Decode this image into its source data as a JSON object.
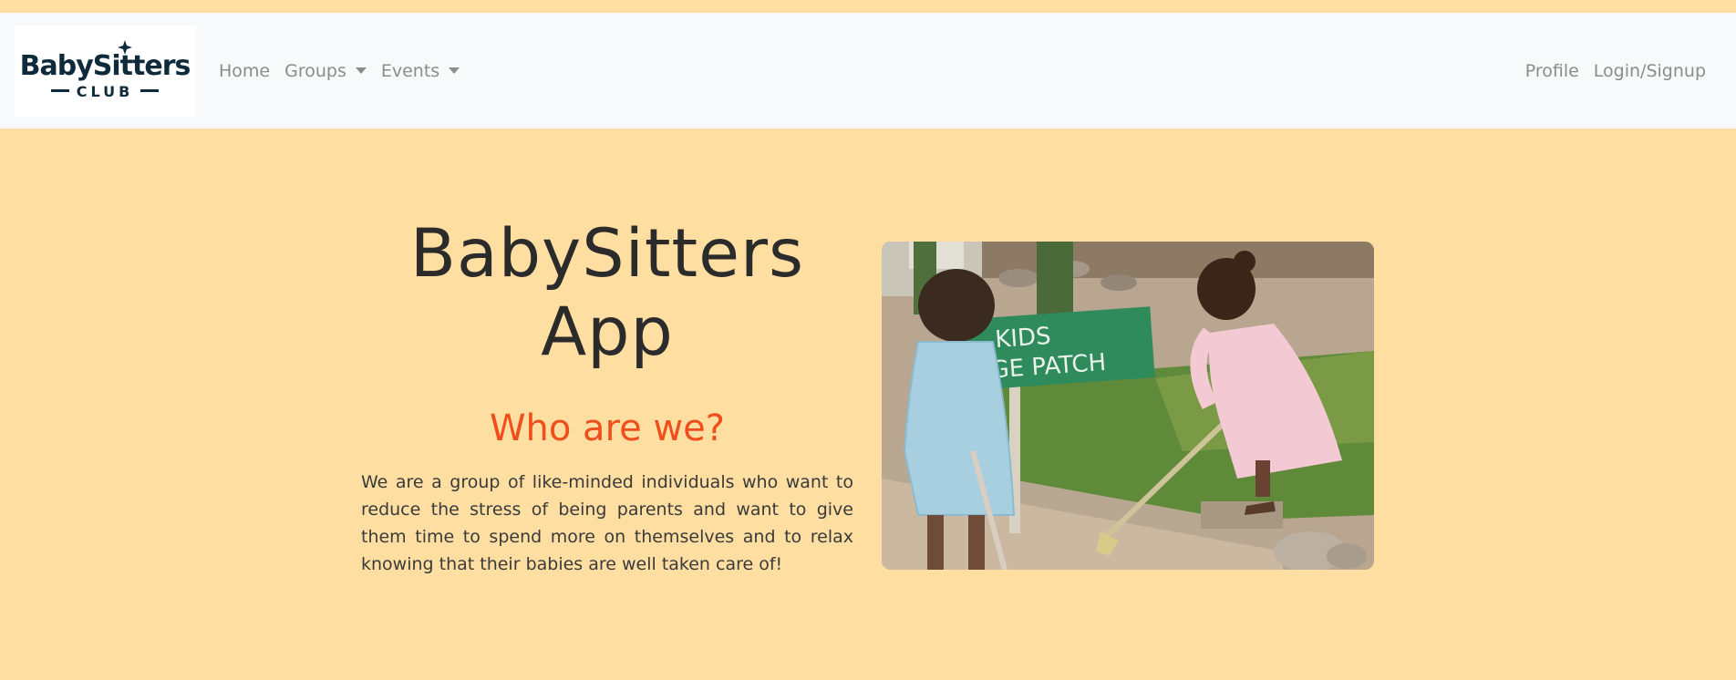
{
  "navbar": {
    "brand_logo": {
      "line1": "BabySitters",
      "line2": "CLUB",
      "icon": "sparkle-icon"
    },
    "left_links": [
      {
        "label": "Home",
        "dropdown": false
      },
      {
        "label": "Groups",
        "dropdown": true
      },
      {
        "label": "Events",
        "dropdown": true
      }
    ],
    "right_links": [
      {
        "label": "Profile"
      },
      {
        "label": "Login/Signup"
      }
    ]
  },
  "hero": {
    "title": "BabySitters App",
    "subtitle": "Who are we?",
    "body": "We are a group of like-minded individuals who want to reduce the stress of being parents and want to give them time to spend more on themselves and to relax knowing that their babies are well taken care of!",
    "photo": {
      "sign_line1": "KIDS",
      "sign_line2": "GE PATCH"
    }
  },
  "colors": {
    "page_background": "#ffdea2",
    "navbar_background": "#f8f9fa",
    "nav_link": "#8c8c8c",
    "title": "#2b2b2b",
    "subtitle_accent": "#f04e1a"
  }
}
